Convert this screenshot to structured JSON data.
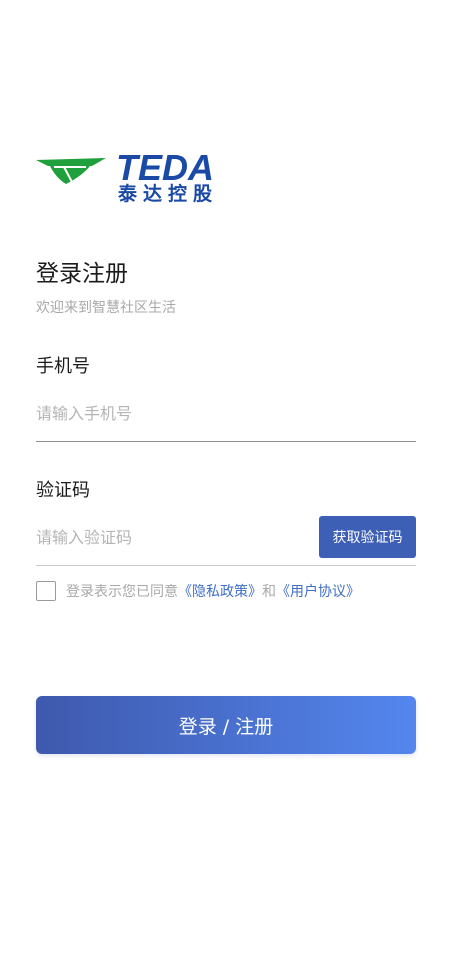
{
  "logo": {
    "brand": "TEDA",
    "subtitle": "泰达控股"
  },
  "header": {
    "title": "登录注册",
    "subtitle": "欢迎来到智慧社区生活"
  },
  "phone": {
    "label": "手机号",
    "placeholder": "请输入手机号"
  },
  "code": {
    "label": "验证码",
    "placeholder": "请输入验证码",
    "button_label": "获取验证码"
  },
  "agreement": {
    "text_prefix": "登录表示您已同意",
    "privacy_link": "《隐私政策》",
    "connector": "和",
    "user_link": "《用户协议》",
    "checked": false
  },
  "submit": {
    "label": "登录 / 注册"
  },
  "colors": {
    "brand_blue": "#1a4aa6",
    "brand_green": "#1fa03c",
    "accent": "#3d5fb5",
    "link": "#3f6fc4"
  }
}
